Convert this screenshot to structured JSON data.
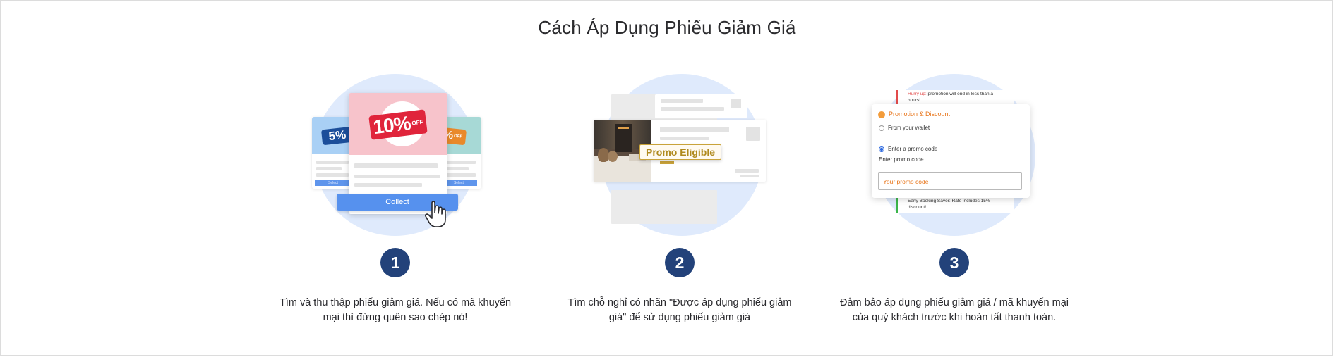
{
  "page": {
    "title": "Cách Áp Dụng Phiếu Giảm Giá"
  },
  "steps": [
    {
      "number": "1",
      "description": "Tìm và thu thập phiếu giảm giá. Nếu có mã khuyến mại thì đừng quên sao chép nó!",
      "illustration": {
        "main_coupon": "10%",
        "main_coupon_sub": "OFF",
        "left_coupon": "5%",
        "right_coupon": "6%",
        "right_coupon_sub": "OFF",
        "collect_label": "Collect",
        "mini_left_button": "Select",
        "mini_right_button": "Select"
      }
    },
    {
      "number": "2",
      "description": "Tìm chỗ nghỉ có nhãn \"Được áp dụng phiếu giảm giá\" để sử dụng phiếu giảm giá",
      "illustration": {
        "badge": "Promo Eligible"
      }
    },
    {
      "number": "3",
      "description": "Đảm bảo áp dụng phiếu giảm giá / mã khuyến mại của quý khách trước khi hoàn tất thanh toán.",
      "illustration": {
        "hurry_prefix": "Hurry up:",
        "hurry_text": "promotion will end in less than a",
        "hurry_text_2": "hours!",
        "panel_title": "Promotion & Discount",
        "option_wallet": "From your wallet",
        "option_promo": "Enter a promo code",
        "input_label": "Enter promo code",
        "input_placeholder": "Your promo code",
        "early_text": "Early Booking Saver: Rate includes 15%",
        "early_text_2": "discount!"
      }
    }
  ],
  "colors": {
    "circle_bg": "#dfeafc",
    "step_number_bg": "#23427a",
    "collect_button": "#5691ee",
    "promo_orange": "#e8751a",
    "badge_gold": "#c9a33a"
  }
}
